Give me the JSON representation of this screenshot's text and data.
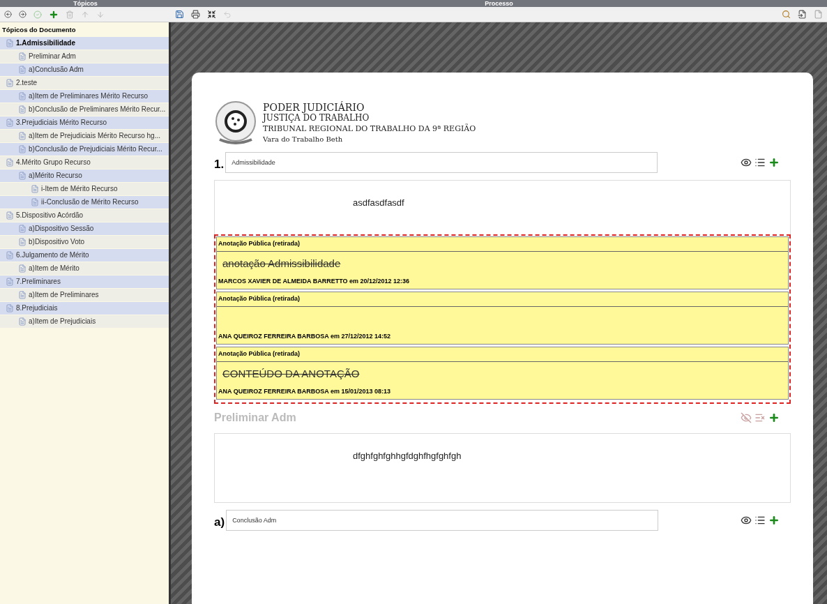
{
  "panels": {
    "left_title": "Tópicos",
    "right_title": "Processo"
  },
  "tree": {
    "title": "Tópicos do Documento",
    "items": [
      {
        "label": "1.Admissibilidade",
        "selected": true,
        "children": [
          {
            "label": "Preliminar Adm",
            "selected": false
          },
          {
            "label": "a)Conclusão Adm",
            "selected": false
          }
        ]
      },
      {
        "label": "2.teste",
        "selected": false,
        "children": [
          {
            "label": "a)Item de Preliminares Mérito Recurso",
            "selected": false
          },
          {
            "label": "b)Conclusão de Preliminares Mérito Recur...",
            "selected": false
          }
        ]
      },
      {
        "label": "3.Prejudiciais Mérito Recurso",
        "selected": false,
        "children": [
          {
            "label": "a)Item de Prejudiciais Mérito Recurso hg...",
            "selected": false
          },
          {
            "label": "b)Conclusão de Prejudiciais Mérito Recur...",
            "selected": false
          }
        ]
      },
      {
        "label": "4.Mérito Grupo Recurso",
        "selected": false,
        "children": [
          {
            "label": "a)Mérito Recurso",
            "selected": false,
            "children": [
              {
                "label": "i-Item de Mérito Recurso",
                "selected": false
              },
              {
                "label": "ii-Conclusão de Mérito Recurso",
                "selected": false
              }
            ]
          }
        ]
      },
      {
        "label": "5.Dispositivo Acórdão",
        "selected": false,
        "children": [
          {
            "label": "a)Dispositivo Sessão",
            "selected": false
          },
          {
            "label": "b)Dispositivo Voto",
            "selected": false
          }
        ]
      },
      {
        "label": "6.Julgamento de Mérito",
        "selected": false,
        "children": [
          {
            "label": "a)Item de Mérito",
            "selected": false
          }
        ]
      },
      {
        "label": "7.Preliminares",
        "selected": false,
        "children": [
          {
            "label": "a)Item de Preliminares",
            "selected": false
          }
        ]
      },
      {
        "label": "8.Prejudiciais",
        "selected": false,
        "children": [
          {
            "label": "a)Item de Prejudiciais",
            "selected": false
          }
        ]
      }
    ]
  },
  "letterhead": [
    "PODER JUDICIÁRIO",
    "JUSTIÇA DO TRABALHO",
    "TRIBUNAL REGIONAL DO TRABALHO DA 9ª REGIÃO",
    "Vara do Trabalho Beth"
  ],
  "sections": [
    {
      "kind": "field",
      "number": "1.",
      "value": "Admissibilidade",
      "body": "asdfasdfasdf",
      "annotations": [
        {
          "header": "Anotação Pública (retirada)",
          "text": "anotação Admissibilidade",
          "struck": true,
          "footer": "MARCOS XAVIER DE ALMEIDA BARRETTO em 20/12/2012 12:36"
        },
        {
          "header": "Anotação Pública (retirada)",
          "footer": "ANA QUEIROZ FERREIRA BARBOSA em 27/12/2012 14:52"
        },
        {
          "header": "Anotação Pública (retirada)",
          "text": "CONTEÚDO DA ANOTAÇÃO",
          "struck": true,
          "footer": "ANA QUEIROZ FERREIRA BARBOSA em 15/01/2013 08:13"
        }
      ]
    },
    {
      "kind": "heading",
      "title": "Preliminar Adm",
      "disabled": true,
      "body": "dfghfghfghhgfdghfhgfghfgh"
    },
    {
      "kind": "field",
      "number": "a)",
      "value": "Conclusão Adm"
    }
  ]
}
